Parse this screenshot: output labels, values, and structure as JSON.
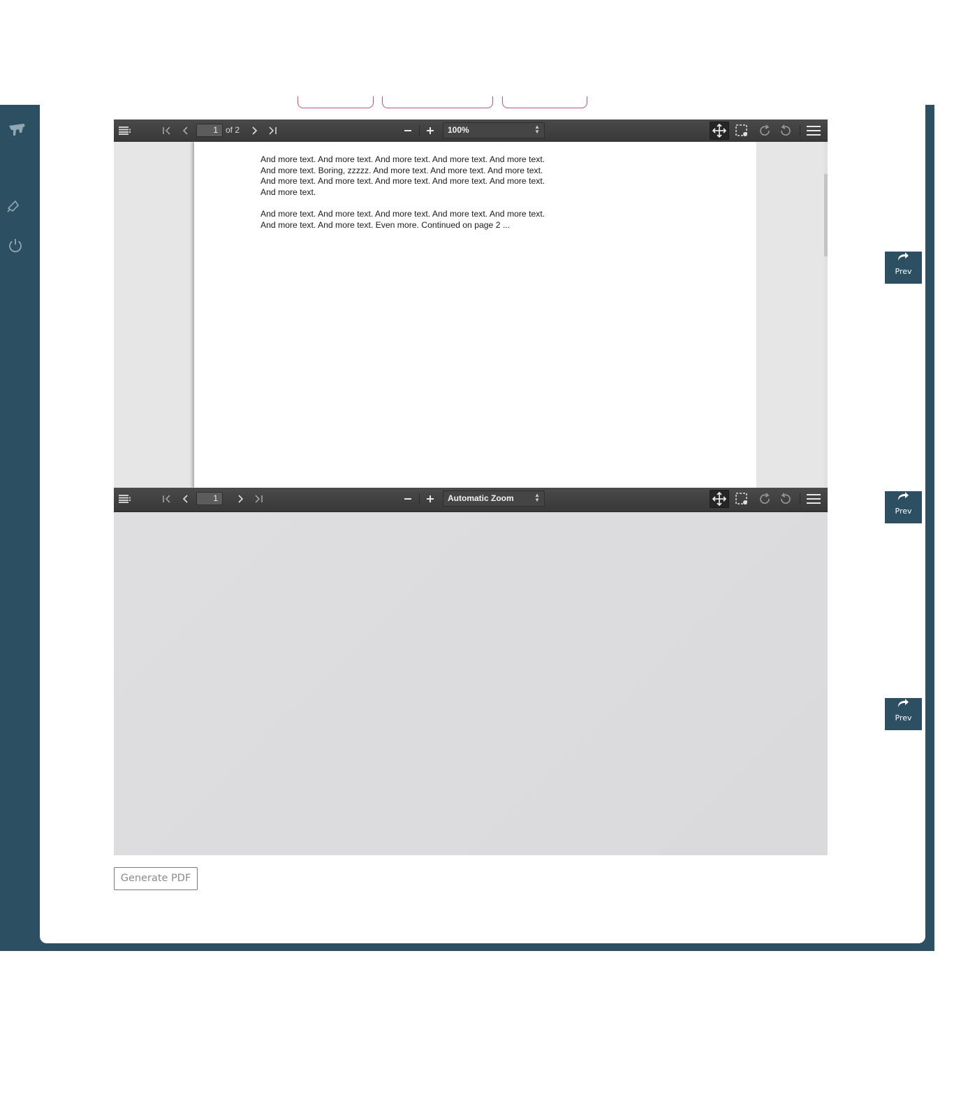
{
  "sidebar": {
    "icons": [
      "logo-icon",
      "bell-icon",
      "power-icon"
    ]
  },
  "viewer1": {
    "page_number": "1",
    "page_count_label": "of 2",
    "zoom": "100%",
    "paragraphs": [
      "And more text. And more text. And more text. And more text. And more text. And more text. Boring, zzzzz. And more text. And more text. And more text. And more text. And more text. And more text. And more text. And more text. And more text.",
      "And more text. And more text. And more text. And more text. And more text. And more text. And more text. Even more. Continued on page 2 ..."
    ]
  },
  "viewer2": {
    "page_number": "1",
    "zoom": "Automatic Zoom"
  },
  "prev_buttons": [
    "Prev",
    "Prev",
    "Prev"
  ],
  "generate_button": "Generate PDF",
  "colors": {
    "frame": "#2c5062",
    "tab_outline": "#c2507e",
    "toolbar": "#3f3f3f"
  }
}
